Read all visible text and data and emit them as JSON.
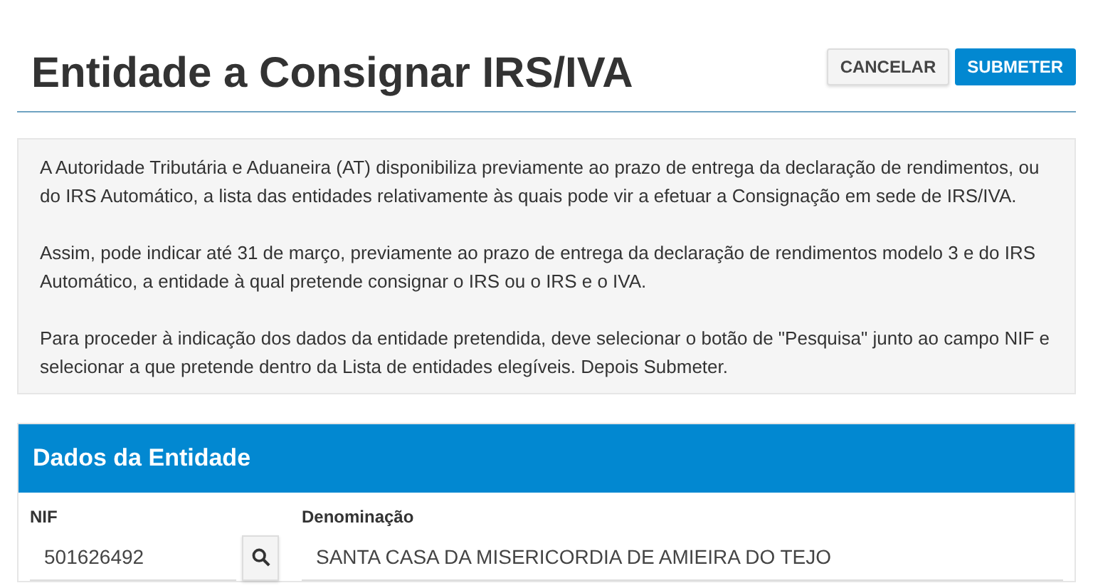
{
  "page": {
    "title": "Entidade a Consignar IRS/IVA"
  },
  "buttons": [
    {
      "label": "CANCELAR",
      "kind": "secondary"
    },
    {
      "label": "SUBMETER",
      "kind": "primary"
    }
  ],
  "info": [
    "A Autoridade Tributária e Aduaneira (AT) disponibiliza previamente ao prazo de entrega da declaração de rendimentos, ou do IRS Automático, a lista das entidades relativamente às quais pode vir a efetuar a Consignação em sede de IRS/IVA.",
    "Assim, pode indicar até 31 de março, previamente ao prazo de entrega da declaração de rendimentos modelo 3 e do IRS Automático, a entidade à qual pretende consignar o IRS ou o IRS e o IVA.",
    "Para proceder à indicação dos dados da entidade pretendida, deve selecionar o botão de \"Pesquisa\" junto ao campo NIF e selecionar a que pretende dentro da Lista de entidades elegíveis. Depois Submeter."
  ],
  "panel": {
    "title": "Dados da Entidade",
    "fields": [
      {
        "label": "NIF",
        "value": "501626492",
        "kind": "search"
      },
      {
        "label": "Denominação",
        "value": "SANTA CASA DA MISERICORDIA DE AMIEIRA DO TEJO",
        "kind": "text"
      }
    ]
  }
}
